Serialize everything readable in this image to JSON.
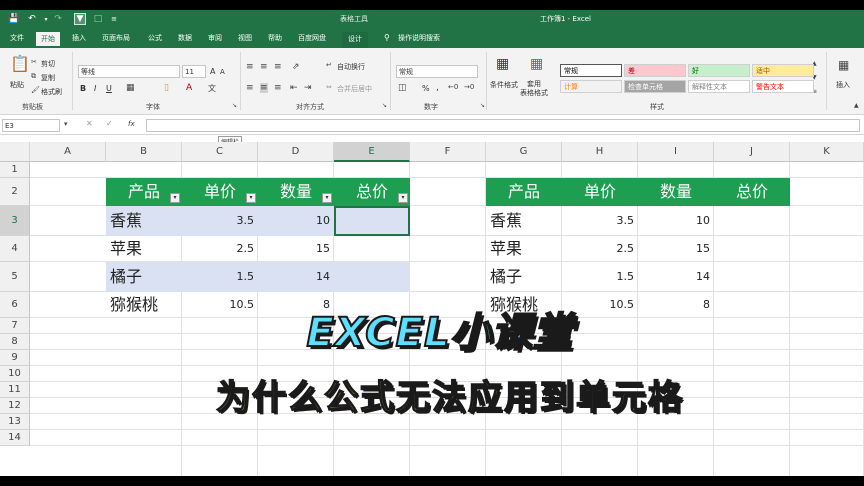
{
  "titlebar": {
    "context_tab_group": "表格工具",
    "window_title": "工作簿1 - Excel"
  },
  "tabs": [
    "文件",
    "开始",
    "插入",
    "页面布局",
    "公式",
    "数据",
    "审阅",
    "视图",
    "帮助",
    "百度网盘",
    "设计",
    "操作说明搜索"
  ],
  "ribbon": {
    "clipboard": {
      "paste": "粘贴",
      "cut": "剪切",
      "copy": "复制",
      "format_painter": "格式刷",
      "label": "剪贴板"
    },
    "font": {
      "name": "等线",
      "size": "11",
      "label": "字体",
      "bold": "B",
      "italic": "I",
      "underline": "U",
      "grow": "A",
      "shrink": "A"
    },
    "alignment": {
      "wrap": "自动换行",
      "merge": "合并后居中",
      "label": "对齐方式"
    },
    "number": {
      "format": "常规",
      "percent": "%",
      "comma": ",",
      "label": "数字"
    },
    "styles": {
      "conditional": "条件格式",
      "table": "套用\n表格格式",
      "cells": [
        {
          "text": "常规",
          "bg": "#ffffff",
          "fg": "#000000"
        },
        {
          "text": "差",
          "bg": "#ffc7ce",
          "fg": "#9c0006"
        },
        {
          "text": "好",
          "bg": "#c6efce",
          "fg": "#006100"
        },
        {
          "text": "适中",
          "bg": "#ffeb9c",
          "fg": "#9c5700"
        },
        {
          "text": "计算",
          "bg": "#f2f2f2",
          "fg": "#fa7d00"
        },
        {
          "text": "检查单元格",
          "bg": "#a5a5a5",
          "fg": "#ffffff"
        },
        {
          "text": "解释性文本",
          "bg": "#ffffff",
          "fg": "#7f7f7f"
        },
        {
          "text": "警告文本",
          "bg": "#ffffff",
          "fg": "#ff0000"
        }
      ],
      "label": "样式"
    },
    "insert": "插入"
  },
  "formula_bar": {
    "name_box": "E3",
    "fx": "fx",
    "tooltip": "编辑栏"
  },
  "columns": [
    "A",
    "B",
    "C",
    "D",
    "E",
    "F",
    "G",
    "H",
    "I",
    "J",
    "K"
  ],
  "rows": [
    "1",
    "2",
    "3",
    "4",
    "5",
    "6",
    "7",
    "8",
    "9",
    "10",
    "11",
    "12",
    "13",
    "14"
  ],
  "table_left": {
    "headers": [
      "产品",
      "单价",
      "数量",
      "总价"
    ],
    "rows": [
      [
        "香蕉",
        "3.5",
        "10",
        ""
      ],
      [
        "苹果",
        "2.5",
        "15",
        ""
      ],
      [
        "橘子",
        "1.5",
        "14",
        ""
      ],
      [
        "猕猴桃",
        "10.5",
        "8",
        ""
      ]
    ]
  },
  "table_right": {
    "headers": [
      "产品",
      "单价",
      "数量",
      "总价"
    ],
    "rows": [
      [
        "香蕉",
        "3.5",
        "10",
        ""
      ],
      [
        "苹果",
        "2.5",
        "15",
        ""
      ],
      [
        "橘子",
        "1.5",
        "14",
        ""
      ],
      [
        "猕猴桃",
        "10.5",
        "8",
        ""
      ]
    ]
  },
  "overlay": {
    "title": "EXCEL小课堂",
    "subtitle": "为什么公式无法应用到单元格"
  },
  "colors": {
    "excel_green": "#217346",
    "header_green": "#1e9e50",
    "band_blue": "#d9e1f2"
  }
}
